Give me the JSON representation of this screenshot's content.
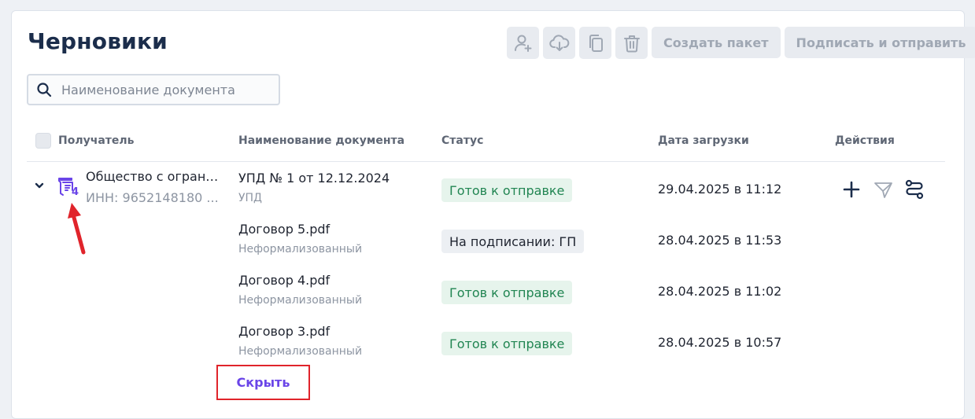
{
  "page": {
    "title": "Черновики"
  },
  "toolbar": {
    "icons": [
      "add-user-icon",
      "cloud-download-icon",
      "copy-icon",
      "trash-icon"
    ],
    "create_package_label": "Создать пакет",
    "sign_and_send_label": "Подписать и отправить"
  },
  "search": {
    "placeholder": "Наименование документа",
    "value": ""
  },
  "table": {
    "headers": {
      "recipient": "Получатель",
      "doc_name": "Наименование документа",
      "status": "Статус",
      "upload_date": "Дата загрузки",
      "actions": "Действия"
    },
    "group": {
      "recipient_name": "Общество с ограниченной ответственностью",
      "inn": "ИНН: 9652148180 ...",
      "doc_count": "4",
      "expanded": true,
      "rows": [
        {
          "name": "УПД № 1 от 12.12.2024",
          "type": "УПД",
          "status": "Готов к отправке",
          "status_kind": "ready",
          "date": "29.04.2025 в 11:12"
        },
        {
          "name": "Договор 5.pdf",
          "type": "Неформализованный",
          "status": "На подписании: ГП",
          "status_kind": "signing",
          "date": "28.04.2025 в 11:53"
        },
        {
          "name": "Договор 4.pdf",
          "type": "Неформализованный",
          "status": "Готов к отправке",
          "status_kind": "ready",
          "date": "28.04.2025 в 11:02"
        },
        {
          "name": "Договор 3.pdf",
          "type": "Неформализованный",
          "status": "Готов к отправке",
          "status_kind": "ready",
          "date": "28.04.2025 в 10:57"
        }
      ],
      "actions": [
        "plus-icon",
        "send-icon",
        "route-icon"
      ],
      "hide_label": "Скрыть"
    }
  },
  "colors": {
    "accent": "#6a45e8",
    "ready_bg": "#e6f4ec",
    "ready_text": "#218552",
    "highlight_red": "#e0242b"
  }
}
